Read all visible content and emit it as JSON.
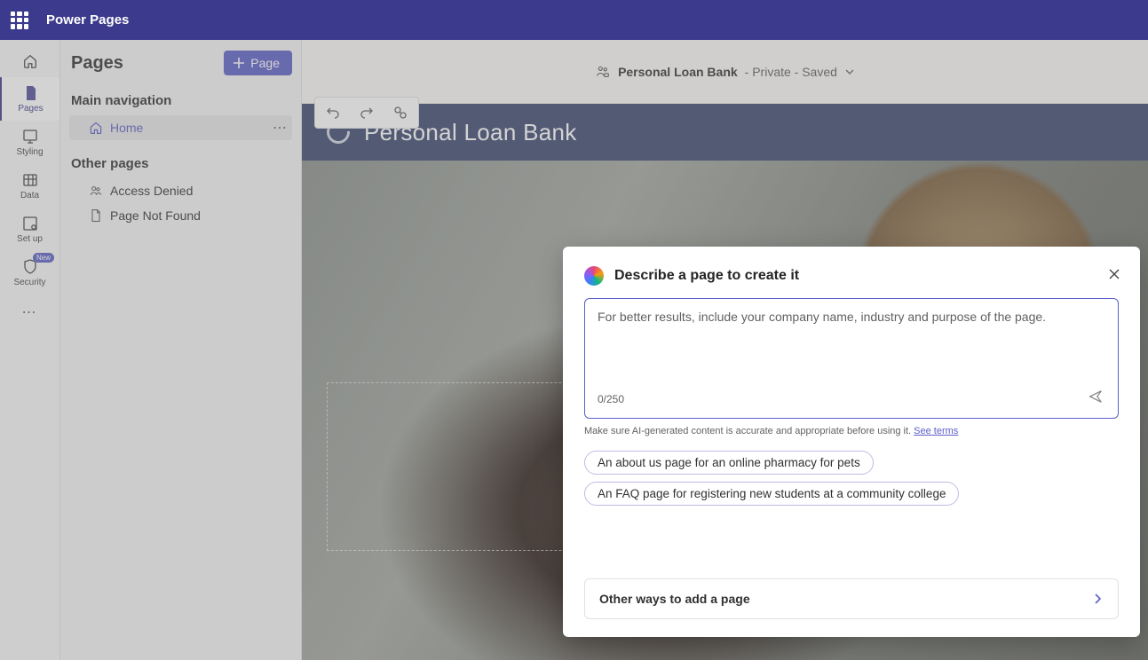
{
  "topbar": {
    "product": "Power Pages"
  },
  "rail": {
    "items": [
      {
        "label": "Pages"
      },
      {
        "label": "Styling"
      },
      {
        "label": "Data"
      },
      {
        "label": "Set up"
      },
      {
        "label": "Security",
        "badge": "New"
      }
    ]
  },
  "sidepanel": {
    "title": "Pages",
    "add_button": "Page",
    "main_nav_label": "Main navigation",
    "home_label": "Home",
    "other_pages_label": "Other pages",
    "other_pages": [
      {
        "label": "Access Denied"
      },
      {
        "label": "Page Not Found"
      }
    ]
  },
  "siteinfo": {
    "name": "Personal Loan Bank",
    "status": "- Private - Saved"
  },
  "preview": {
    "site_title": "Personal Loan Bank"
  },
  "copilot": {
    "title": "Describe a page to create it",
    "placeholder": "For better results, include your company name, industry and purpose of the page.",
    "char_count": "0/250",
    "disclaimer_text": "Make sure AI-generated content is accurate and appropriate before using it. ",
    "terms_link": "See terms",
    "suggestions": [
      "An about us page for an online pharmacy for pets",
      "An FAQ page for registering new students at a community college"
    ],
    "other_ways": "Other ways to add a page"
  }
}
